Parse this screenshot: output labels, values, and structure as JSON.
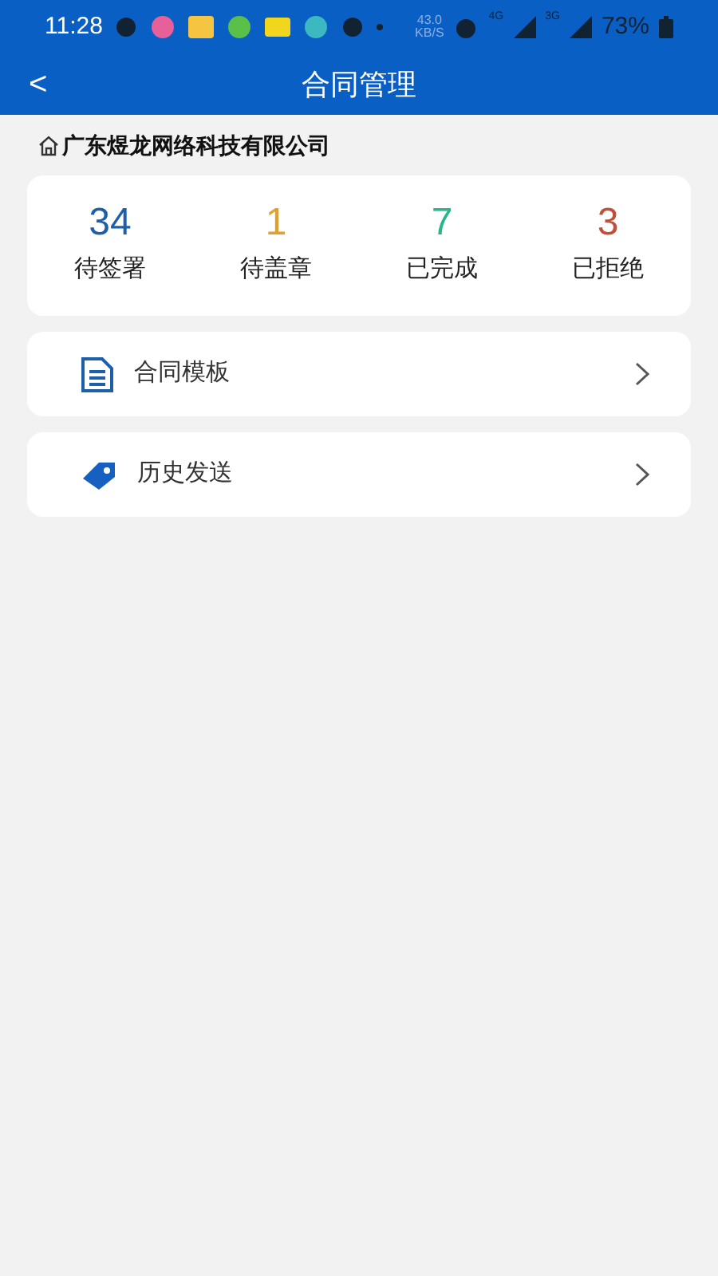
{
  "status_bar": {
    "time": "11:28",
    "speed": "43.0",
    "speed_unit": "KB/S",
    "network_1": "4G",
    "network_2": "3G",
    "battery": "73%"
  },
  "header": {
    "back": "<",
    "title": "合同管理"
  },
  "company": {
    "name": "广东煜龙网络科技有限公司"
  },
  "stats": [
    {
      "value": "34",
      "label": "待签署",
      "color": "#1f5fa8"
    },
    {
      "value": "1",
      "label": "待盖章",
      "color": "#e0a030"
    },
    {
      "value": "7",
      "label": "已完成",
      "color": "#2bb48a"
    },
    {
      "value": "3",
      "label": "已拒绝",
      "color": "#c0503a"
    }
  ],
  "menu": [
    {
      "kind": "document",
      "label": "合同模板"
    },
    {
      "kind": "tag",
      "label": "历史发送"
    }
  ]
}
